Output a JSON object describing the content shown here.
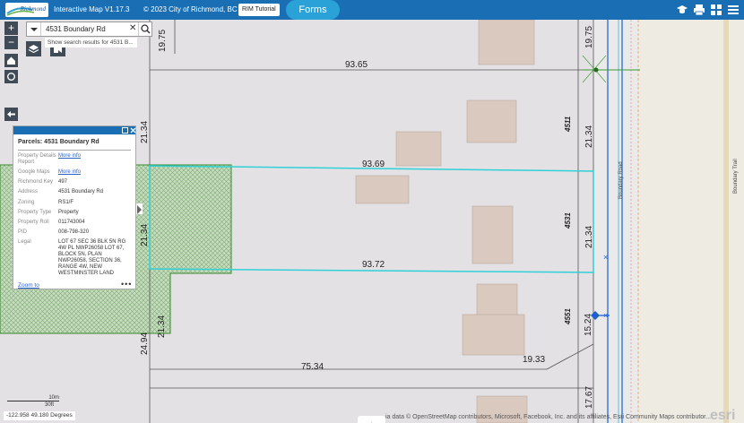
{
  "header": {
    "logo_text": "Richmond",
    "app_title": "Interactive Map V1.17.3",
    "copyright": "© 2023 City of Richmond, BC",
    "rim_tutorial": "RIM Tutorial",
    "forms": "Forms",
    "accent": "#1a6fb4",
    "forms_color": "#2aa2d8"
  },
  "search": {
    "value": "4531 Boundary Rd",
    "hint": "Show search results for 4531 B..."
  },
  "popup": {
    "title": "Parcels: 4531 Boundary Rd",
    "fields": [
      {
        "key": "Property Details Report",
        "value": "More info",
        "link": true
      },
      {
        "key": "Google Maps",
        "value": "More info",
        "link": true
      },
      {
        "key": "Richmond Key",
        "value": "497",
        "link": false
      },
      {
        "key": "Address",
        "value": "4531 Boundary Rd",
        "link": false
      },
      {
        "key": "Zoning",
        "value": "RS1/F",
        "link": false
      },
      {
        "key": "Property Type",
        "value": "Property",
        "link": false
      },
      {
        "key": "Property Roll",
        "value": "011743004",
        "link": false
      },
      {
        "key": "PID",
        "value": "008-798-320",
        "link": false
      },
      {
        "key": "Legal",
        "value": "LOT 67 SEC 36 BLK 5N RG 4W PL NWP26058 LOT 67, BLOCK 5N, PLAN NWP26058, SECTION 36, RANGE 4W, NEW WESTMINSTER LAND",
        "link": false
      }
    ],
    "zoom_to": "Zoom to",
    "more": "•••"
  },
  "map": {
    "dimensions": [
      "19.75",
      "93.65",
      "21.34",
      "93.69",
      "21.34",
      "21.34",
      "93.72",
      "21.34",
      "24.94",
      "75.34",
      "19.33",
      "15.24",
      "17.67",
      "19.75",
      "21.34"
    ],
    "addresses": [
      "4511",
      "4531",
      "4551"
    ],
    "roads": [
      "Boundary Road",
      "Boundary Trail"
    ],
    "scale_m": "10m",
    "scale_ft": "30ft",
    "coords": "-122.958 49.180 Degrees",
    "attribution": "ia data © OpenStreetMap contributors, Microsoft, Facebook, Inc. and its affiliates, Esri Community Maps contributor...",
    "esri": "esri"
  }
}
